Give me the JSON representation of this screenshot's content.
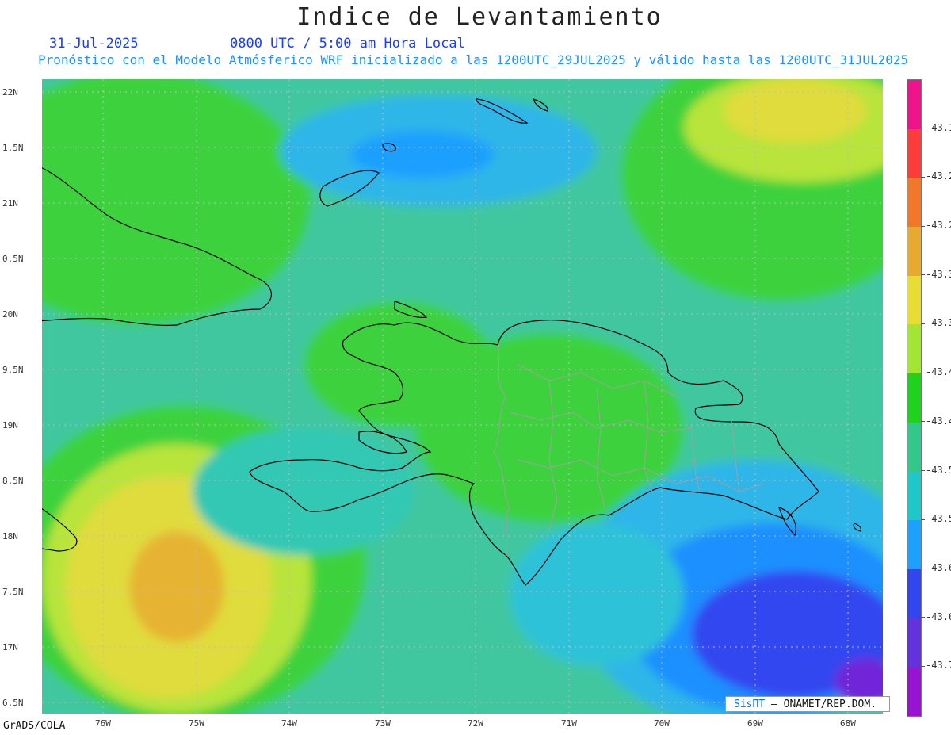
{
  "title": "Indice de Levantamiento",
  "date": "31-Jul-2025",
  "time_line": "0800 UTC / 5:00 am Hora Local",
  "subtitle": "Pronóstico con el Modelo Atmósferico WRF inicializado a las 1200UTC_29JUL2025 y válido hasta las  1200UTC_31JUL2025",
  "lat_labels": [
    "22N",
    "1.5N",
    "21N",
    "0.5N",
    "20N",
    "9.5N",
    "19N",
    "8.5N",
    "18N",
    "7.5N",
    "17N",
    "6.5N"
  ],
  "lon_labels": [
    "76W",
    "75W",
    "74W",
    "73W",
    "72W",
    "71W",
    "70W",
    "69W",
    "68W"
  ],
  "colorbar": {
    "labels": [
      "-43.1",
      "-43.2",
      "-43.2",
      "-43.3",
      "-43.3",
      "-43.4",
      "-43.4",
      "-43.5",
      "-43.5",
      "-43.6",
      "-43.6",
      "-43.7"
    ],
    "colors": [
      "#f0148c",
      "#ff3c3c",
      "#f07828",
      "#e6aa32",
      "#e6dc32",
      "#a0e632",
      "#1ed21e",
      "#32c88c",
      "#1ec8c8",
      "#1ea0ff",
      "#3246f0",
      "#6432dc",
      "#9614d2"
    ]
  },
  "credit": {
    "logo": "SisПT",
    "text": "– ONAMET/REP.DOM."
  },
  "footer": "GrADS/COLA",
  "colors": {
    "title": "#222222",
    "date": "#1a3cff",
    "subtitle": "#1e90ff"
  }
}
